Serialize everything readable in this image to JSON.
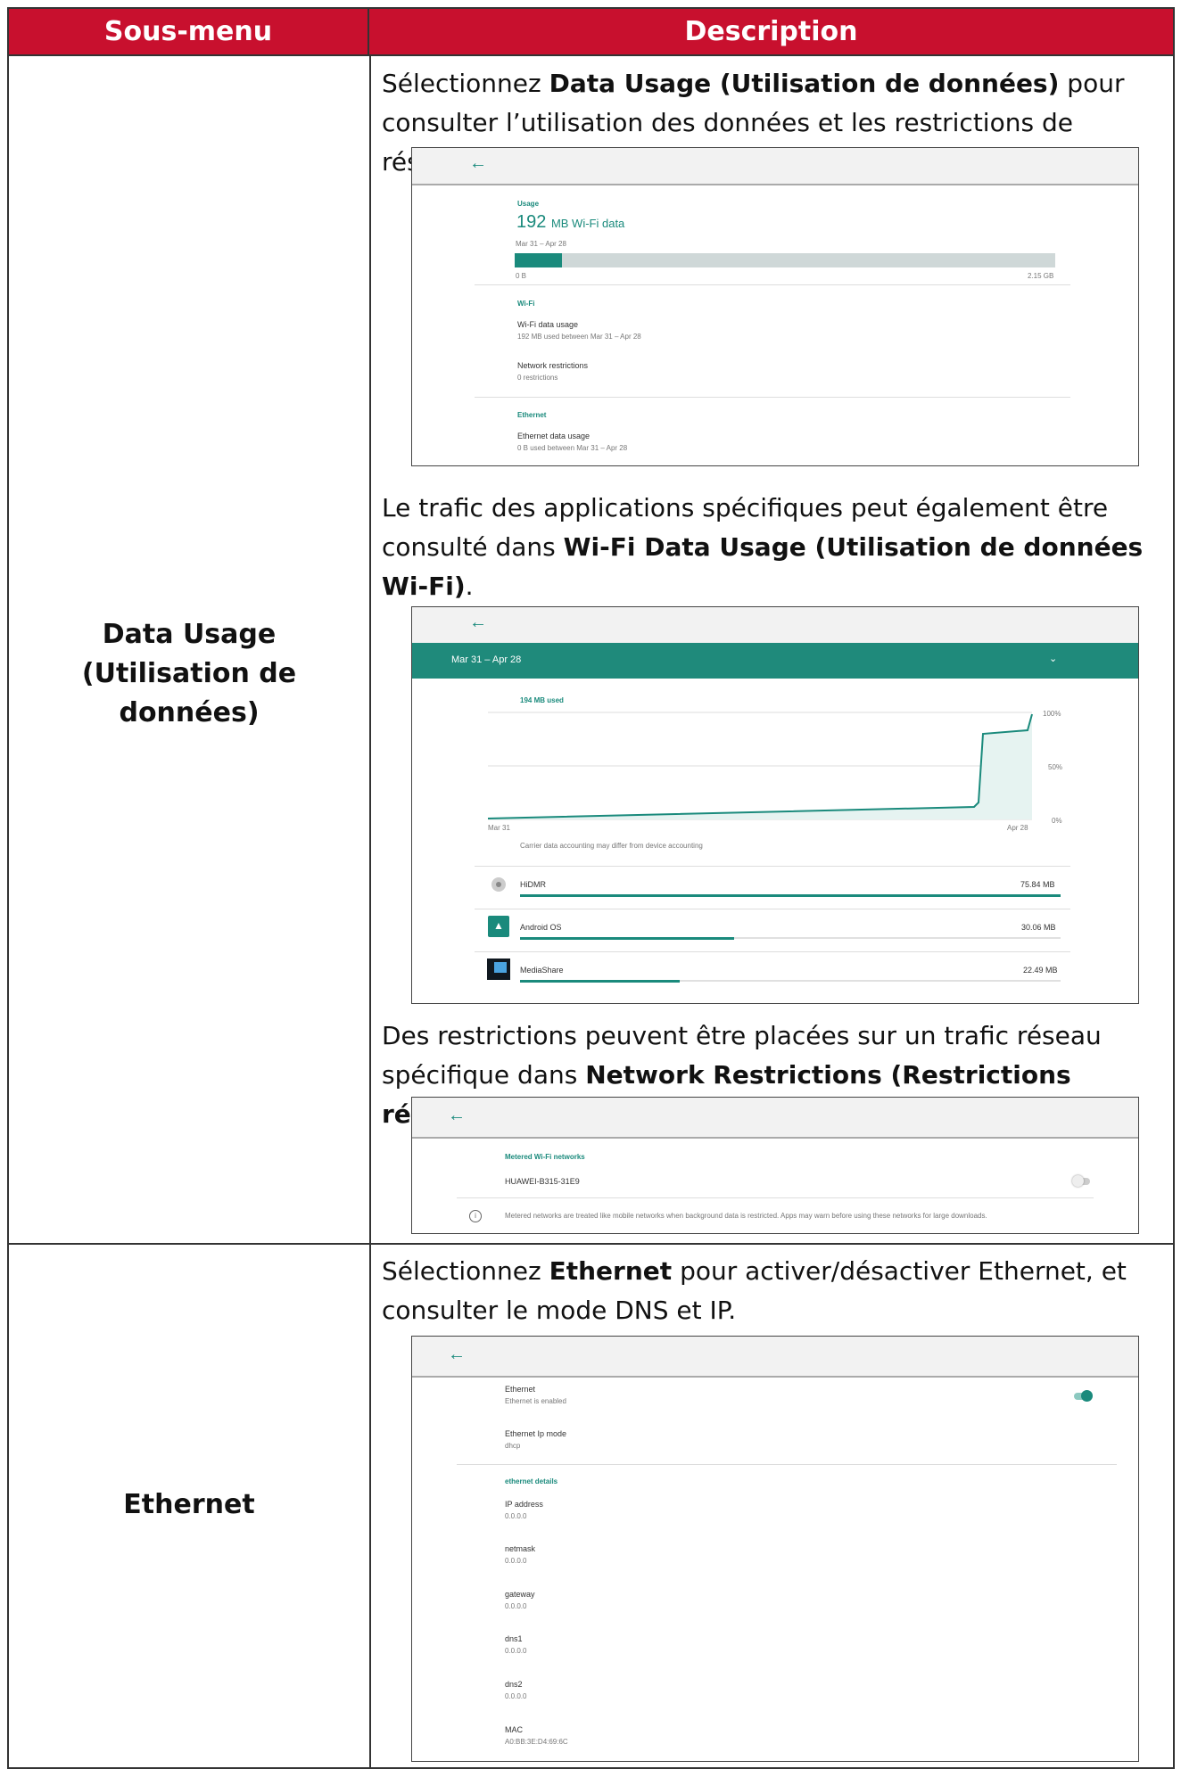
{
  "header": {
    "col1": "Sous-menu",
    "col2": "Description"
  },
  "rows": {
    "data_usage": {
      "label_line1": "Data Usage",
      "label_line2": "(Utilisation de données)",
      "p1_a": "Sélectionnez ",
      "p1_b": "Data Usage (Utilisation de données)",
      "p1_c": " pour consulter l’utilisation des données et les restrictions de réseau.",
      "p2_a": "Le trafic des applications spécifiques peut également être consulté dans ",
      "p2_b": "Wi-Fi Data Usage (Utilisation de données Wi-Fi)",
      "p2_c": ".",
      "p3_a": "Des restrictions peuvent être placées sur un trafic réseau spécifique dans ",
      "p3_b": "Network Restrictions (Restrictions réseau)",
      "p3_c": "."
    },
    "ethernet": {
      "label": "Ethernet",
      "p1_a": "Sélectionnez ",
      "p1_b": "Ethernet",
      "p1_c": " pour activer/désactiver Ethernet, et consulter le mode DNS et IP."
    }
  },
  "shot1": {
    "back": "←",
    "usage_label": "Usage",
    "amount_num": "192",
    "amount_unit": "MB Wi-Fi data",
    "period": "Mar 31 – Apr 28",
    "usage_fraction": 0.087,
    "bar_min": "0 B",
    "bar_max": "2.15 GB",
    "wifi_section": "Wi-Fi",
    "wifi_data_title": "Wi-Fi data usage",
    "wifi_data_sub": "192 MB used between Mar 31 – Apr 28",
    "net_restr_title": "Network restrictions",
    "net_restr_sub": "0 restrictions",
    "eth_section": "Ethernet",
    "eth_data_title": "Ethernet data usage",
    "eth_data_sub": "0 B used between Mar 31 – Apr 28"
  },
  "shot2": {
    "back": "←",
    "period": "Mar 31 – Apr 28",
    "used": "194 MB used",
    "y_100": "100%",
    "y_50": "50%",
    "y_0": "0%",
    "x_start": "Mar 31",
    "x_end": "Apr 28",
    "note": "Carrier data accounting may differ from device accounting",
    "apps": [
      {
        "name": "HiDMR",
        "size": "75.84 MB",
        "fraction": 1.0
      },
      {
        "name": "Android OS",
        "size": "30.06 MB",
        "fraction": 0.396
      },
      {
        "name": "MediaShare",
        "size": "22.49 MB",
        "fraction": 0.296
      }
    ]
  },
  "shot3": {
    "back": "←",
    "section": "Metered Wi-Fi networks",
    "network": "HUAWEI-B315-31E9",
    "info": "Metered networks are treated like mobile networks when background data is restricted. Apps may warn before using these networks for large downloads."
  },
  "shot4": {
    "back": "←",
    "eth_title": "Ethernet",
    "eth_sub": "Ethernet is enabled",
    "ipmode_title": "Ethernet Ip mode",
    "ipmode_sub": "dhcp",
    "details": "ethernet details",
    "ip_title": "IP address",
    "ip_val": "0.0.0.0",
    "mask_title": "netmask",
    "mask_val": "0.0.0.0",
    "gw_title": "gateway",
    "gw_val": "0.0.0.0",
    "dns1_title": "dns1",
    "dns1_val": "0.0.0.0",
    "dns2_title": "dns2",
    "dns2_val": "0.0.0.0",
    "mac_title": "MAC",
    "mac_val": "A0:BB:3E:D4:69:6C"
  },
  "colors": {
    "header_red": "#c8102e",
    "accent_teal": "#1a8a7c"
  }
}
